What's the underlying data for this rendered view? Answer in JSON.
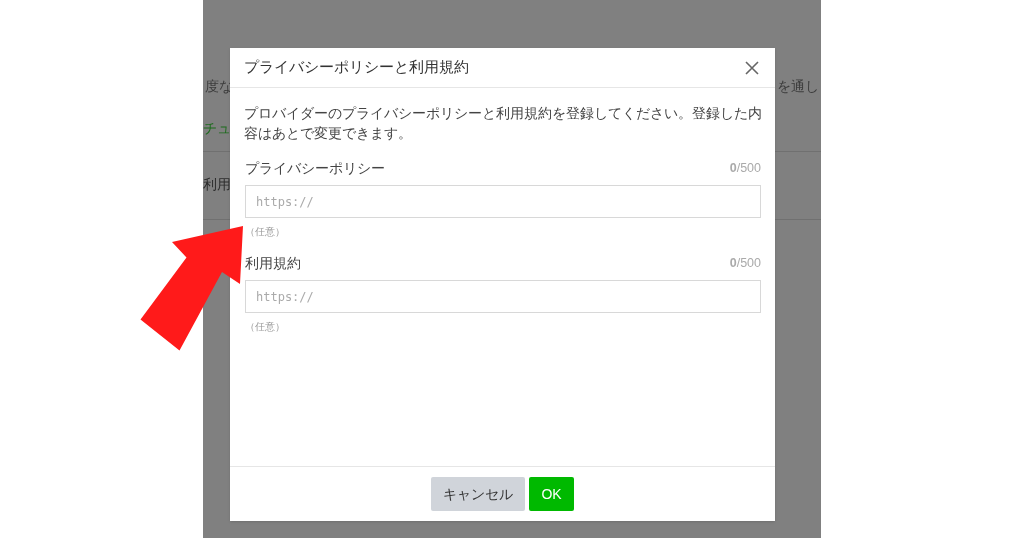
{
  "background": {
    "row_1_left": "度な",
    "row_1_right": "を通し",
    "link": "チュ",
    "row_2": "利用"
  },
  "dialog": {
    "title": "プライバシーポリシーと利用規約",
    "description": "プロバイダーのプライバシーポリシーと利用規約を登録してください。登録した内容はあとで変更できます。",
    "fields": [
      {
        "label": "プライバシーポリシー",
        "count": "**0**/500",
        "placeholder": "https://",
        "hint": "（任意）"
      },
      {
        "label": "利用規約",
        "count": "**0**/500",
        "placeholder": "https://",
        "hint": "（任意）"
      }
    ],
    "buttons": [
      {
        "label": "キャンセル",
        "kind": "secondary"
      },
      {
        "label": "OK",
        "kind": "primary"
      }
    ]
  }
}
